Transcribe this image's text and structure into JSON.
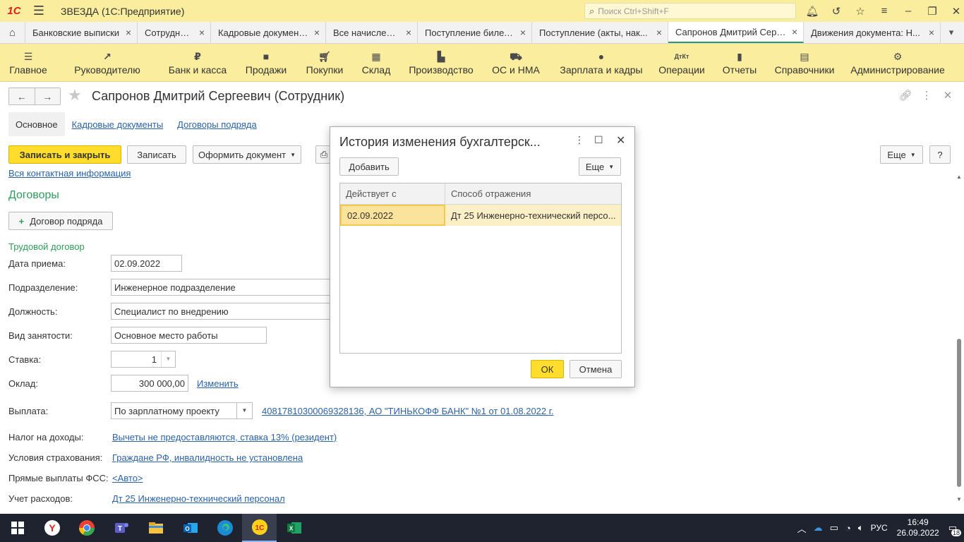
{
  "app": {
    "logo": "1С",
    "title": "ЗВЕЗДА  (1С:Предприятие)",
    "search_placeholder": "Поиск Ctrl+Shift+F"
  },
  "tabs": [
    {
      "label": "Банковские выписки"
    },
    {
      "label": "Сотрудники"
    },
    {
      "label": "Кадровые документы"
    },
    {
      "label": "Все начисления"
    },
    {
      "label": "Поступление билетов"
    },
    {
      "label": "Поступление (акты, нак..."
    },
    {
      "label": "Сапронов Дмитрий Серг..."
    },
    {
      "label": "Движения документа: Н..."
    }
  ],
  "sections": [
    {
      "label": "Главное"
    },
    {
      "label": "Руководителю"
    },
    {
      "label": "Банк и касса"
    },
    {
      "label": "Продажи"
    },
    {
      "label": "Покупки"
    },
    {
      "label": "Склад"
    },
    {
      "label": "Производство"
    },
    {
      "label": "ОС и НМА"
    },
    {
      "label": "Зарплата и кадры"
    },
    {
      "label": "Операции"
    },
    {
      "label": "Отчеты"
    },
    {
      "label": "Справочники"
    },
    {
      "label": "Администрирование"
    }
  ],
  "form": {
    "title": "Сапронов Дмитрий Сергеевич (Сотрудник)",
    "links": {
      "main": "Основное",
      "hr_docs": "Кадровые документы",
      "contracts": "Договоры подряда"
    },
    "commands": {
      "save_close": "Записать и закрыть",
      "save": "Записать",
      "make_doc": "Оформить документ",
      "more": "Еще",
      "help": "?"
    },
    "contact_link": "Вся контактная информация",
    "contracts_header": "Договоры",
    "contract_button": "Договор подряда",
    "labor_header": "Трудовой договор",
    "fields": {
      "hire_date_label": "Дата приема:",
      "hire_date": "02.09.2022",
      "dept_label": "Подразделение:",
      "dept": "Инженерное подразделение",
      "position_label": "Должность:",
      "position": "Специалист по внедрению",
      "employment_label": "Вид занятости:",
      "employment": "Основное место работы",
      "rate_label": "Ставка:",
      "rate": "1",
      "salary_label": "Оклад:",
      "salary": "300 000,00",
      "salary_change": "Изменить",
      "payment_label": "Выплата:",
      "payment": "По зарплатному проекту",
      "payment_project": "40817810300069328136, АО \"ТИНЬКОФФ БАНК\" №1 от 01.08.2022 г.",
      "tax_label": "Налог на доходы:",
      "tax": "Вычеты не предоставляются, ставка 13% (резидент)",
      "insurance_label": "Условия страхования:",
      "insurance": "Граждане РФ, инвалидность не установлена",
      "fss_label": "Прямые выплаты ФСС:",
      "fss": "<Авто>",
      "cost_label": "Учет расходов:",
      "cost": "Дт 25 Инженерно-технический персонал"
    }
  },
  "dialog": {
    "title": "История изменения бухгалтерск...",
    "add_button": "Добавить",
    "more_button": "Еще",
    "columns": [
      "Действует с",
      "Способ отражения"
    ],
    "rows": [
      {
        "date": "02.09.2022",
        "method": "Дт 25 Инженерно-технический персо..."
      }
    ],
    "ok": "ОК",
    "cancel": "Отмена"
  },
  "taskbar": {
    "lang": "РУС",
    "time": "16:49",
    "date": "26.09.2022",
    "notifications": "18"
  }
}
